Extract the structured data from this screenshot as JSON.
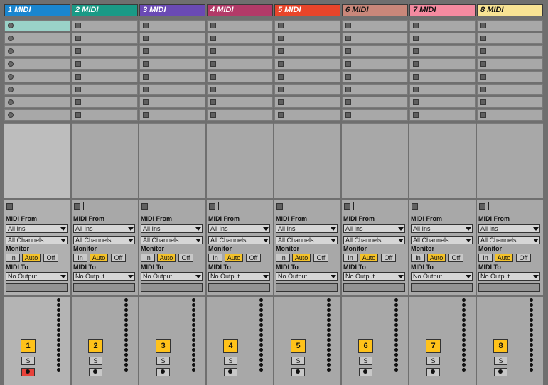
{
  "tracks": [
    {
      "name": "1 MIDI",
      "color": "#1a86cf",
      "text_color": "#ffffff",
      "number": "1",
      "armed": true
    },
    {
      "name": "2 MIDI",
      "color": "#1a9a86",
      "text_color": "#ffffff",
      "number": "2",
      "armed": false
    },
    {
      "name": "3 MIDI",
      "color": "#6a4ab4",
      "text_color": "#ffffff",
      "number": "3",
      "armed": false
    },
    {
      "name": "4 MIDI",
      "color": "#b23a68",
      "text_color": "#ffffff",
      "number": "4",
      "armed": false
    },
    {
      "name": "5 MIDI",
      "color": "#e8452a",
      "text_color": "#ffffff",
      "number": "5",
      "armed": false
    },
    {
      "name": "6 MIDI",
      "color": "#c9877a",
      "text_color": "#111111",
      "number": "6",
      "armed": false
    },
    {
      "name": "7 MIDI",
      "color": "#f48aa0",
      "text_color": "#111111",
      "number": "7",
      "armed": false
    },
    {
      "name": "8 MIDI",
      "color": "#f8e394",
      "text_color": "#111111",
      "number": "8",
      "armed": false
    }
  ],
  "io": {
    "midi_from_label": "MIDI From",
    "input_type": "All Ins",
    "input_channel": "All Channels",
    "monitor_label": "Monitor",
    "monitor_options": [
      "In",
      "Auto",
      "Off"
    ],
    "monitor_selected": "Auto",
    "midi_to_label": "MIDI To",
    "output_type": "No Output"
  },
  "mixer": {
    "solo_label": "S"
  },
  "clip_slots_per_track": 8,
  "colors": {
    "accent": "#f3c22b",
    "arm_active": "#e8423a",
    "selected_slot": "#9ad2c8"
  },
  "icons": {
    "record": "circle-record-icon",
    "stop": "square-stop-icon",
    "arm": "record-arm-icon",
    "dropdown": "chevron-down-icon"
  }
}
